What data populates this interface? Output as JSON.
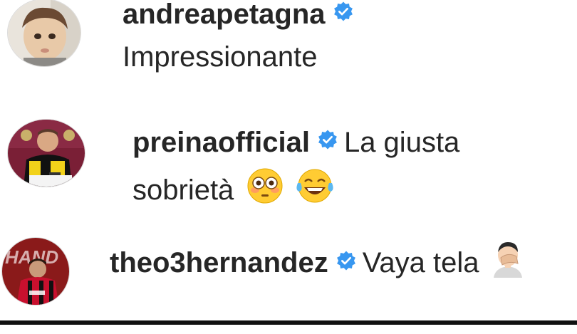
{
  "comments": [
    {
      "username": "andreapetagna",
      "verified": true,
      "text_line1": "",
      "text_line2": "Impressionante",
      "avatar_icon": "baby-photo-avatar"
    },
    {
      "username": "preinaofficial",
      "verified": true,
      "text_line1": "La giusta",
      "text_line2": "sobrietà",
      "emojis": [
        "flushed-face-emoji",
        "tears-of-joy-emoji"
      ],
      "avatar_icon": "goalkeeper-signing-avatar"
    },
    {
      "username": "theo3hernandez",
      "verified": true,
      "text_line1": "Vaya tela",
      "emojis": [
        "facepalm-emoji"
      ],
      "avatar_icon": "milan-player-avatar"
    }
  ],
  "colors": {
    "verified_badge": "#3897f0",
    "text": "#262626",
    "meta_text": "#8e8e8e"
  }
}
